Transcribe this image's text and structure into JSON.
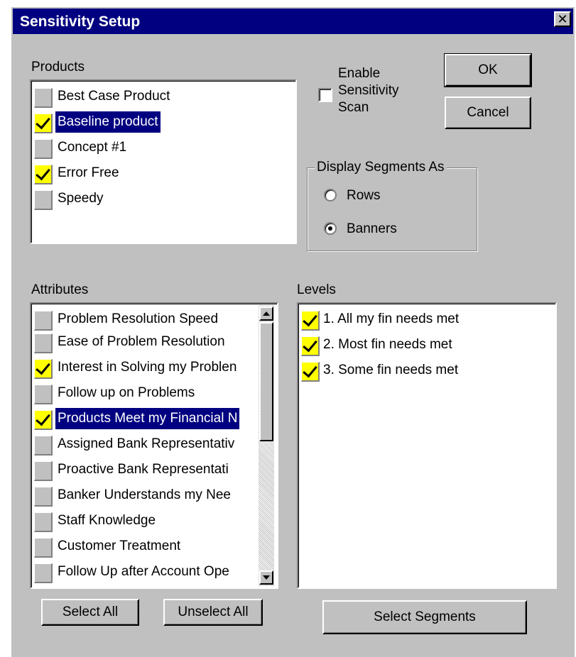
{
  "window": {
    "title": "Sensitivity Setup",
    "close_glyph": "✕"
  },
  "products": {
    "label": "Products",
    "items": [
      {
        "label": "Best Case Product",
        "checked": false,
        "selected": false
      },
      {
        "label": "Baseline product",
        "checked": true,
        "selected": true
      },
      {
        "label": "Concept #1",
        "checked": false,
        "selected": false
      },
      {
        "label": "Error Free",
        "checked": true,
        "selected": false
      },
      {
        "label": "Speedy",
        "checked": false,
        "selected": false
      }
    ]
  },
  "sensitivity": {
    "label_line1": "Enable",
    "label_line2": "Sensitivity",
    "label_line3": "Scan",
    "checked": false
  },
  "buttons": {
    "ok": "OK",
    "cancel": "Cancel",
    "select_all": "Select All",
    "unselect_all": "Unselect All",
    "select_segments": "Select Segments"
  },
  "display_segments": {
    "legend": "Display Segments As",
    "options": [
      {
        "label": "Rows",
        "selected": false
      },
      {
        "label": "Banners",
        "selected": true
      }
    ]
  },
  "attributes": {
    "label": "Attributes",
    "items": [
      {
        "label": "Problem Resolution Speed",
        "checked": false,
        "selected": false
      },
      {
        "label": "Ease of Problem Resolution",
        "checked": false,
        "selected": false
      },
      {
        "label": "Interest in Solving my Problen",
        "checked": true,
        "selected": false
      },
      {
        "label": "Follow up on Problems",
        "checked": false,
        "selected": false
      },
      {
        "label": "Products Meet my Financial N",
        "checked": true,
        "selected": true
      },
      {
        "label": "Assigned Bank Representativ",
        "checked": false,
        "selected": false
      },
      {
        "label": "Proactive Bank Representati",
        "checked": false,
        "selected": false
      },
      {
        "label": "Banker Understands my Nee",
        "checked": false,
        "selected": false
      },
      {
        "label": "Staff Knowledge",
        "checked": false,
        "selected": false
      },
      {
        "label": "Customer Treatment",
        "checked": false,
        "selected": false
      },
      {
        "label": "Follow Up after Account Ope",
        "checked": false,
        "selected": false
      }
    ]
  },
  "levels": {
    "label": "Levels",
    "items": [
      {
        "label": "1. All my fin needs met",
        "checked": true
      },
      {
        "label": "2. Most fin needs met",
        "checked": true
      },
      {
        "label": "3. Some fin needs met",
        "checked": true
      }
    ]
  }
}
